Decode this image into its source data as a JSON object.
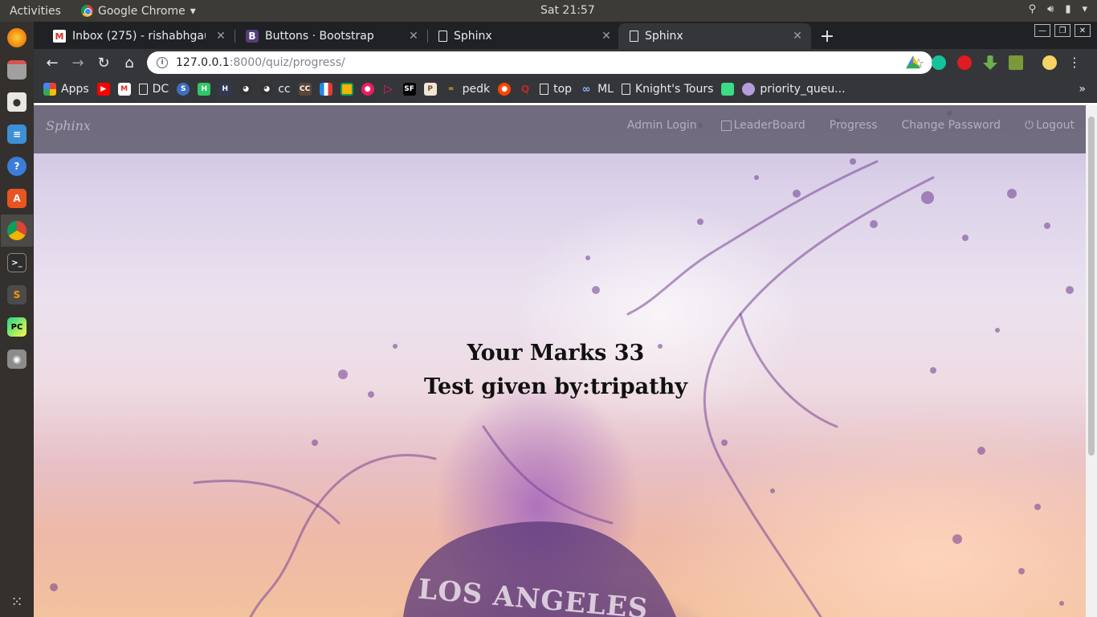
{
  "system": {
    "activities": "Activities",
    "app_name": "Google Chrome",
    "clock": "Sat 21:57"
  },
  "tabs": [
    {
      "title": "Inbox (275) - rishabhgaur",
      "icon": "gmail-icon"
    },
    {
      "title": "Buttons · Bootstrap",
      "icon": "bootstrap-icon"
    },
    {
      "title": "Sphinx",
      "icon": "page-icon"
    },
    {
      "title": "Sphinx",
      "icon": "page-icon",
      "active": true
    }
  ],
  "omnibox": {
    "host": "127.0.0.1",
    "path": ":8000/quiz/progress/"
  },
  "bookmarks": [
    {
      "label": "Apps",
      "icon": "apps-grid-icon"
    },
    {
      "label": "",
      "icon": "youtube-icon"
    },
    {
      "label": "",
      "icon": "gmail-icon"
    },
    {
      "label": "DC",
      "icon": "page-icon"
    },
    {
      "label": "",
      "icon": "s-icon"
    },
    {
      "label": "",
      "icon": "hackerrank-icon"
    },
    {
      "label": "",
      "icon": "hackerearth-icon"
    },
    {
      "label": "",
      "icon": "github-icon"
    },
    {
      "label": "cc",
      "icon": "github-icon"
    },
    {
      "label": "",
      "icon": "codechef-icon"
    },
    {
      "label": "",
      "icon": "chart-icon"
    },
    {
      "label": "",
      "icon": "image-icon"
    },
    {
      "label": "",
      "icon": "record-icon"
    },
    {
      "label": "",
      "icon": "play-icon"
    },
    {
      "label": "",
      "icon": "sf-icon"
    },
    {
      "label": "",
      "icon": "pe-icon"
    },
    {
      "label": "pedk",
      "icon": "bird-icon"
    },
    {
      "label": "",
      "icon": "reddit-icon"
    },
    {
      "label": "",
      "icon": "quora-icon"
    },
    {
      "label": "top",
      "icon": "page-icon"
    },
    {
      "label": "ML",
      "icon": "link-icon"
    },
    {
      "label": "Knight's Tours",
      "icon": "page-icon"
    },
    {
      "label": "",
      "icon": "android-icon"
    },
    {
      "label": "priority_queu...",
      "icon": "game-icon"
    }
  ],
  "site": {
    "brand": "Sphinx",
    "nav": {
      "admin_login": "Admin Login",
      "leaderboard": "LeaderBoard",
      "progress": "Progress",
      "change_password": "Change Password",
      "logout": "Logout"
    },
    "result": {
      "marks_line": "Your Marks 33",
      "given_by_line": "Test given by:tripathy"
    },
    "background_text": "LOS ANGELES"
  },
  "colors": {
    "nav_bg": "#5c5868",
    "chrome_dark": "#202124",
    "toolbar": "#35363a"
  }
}
